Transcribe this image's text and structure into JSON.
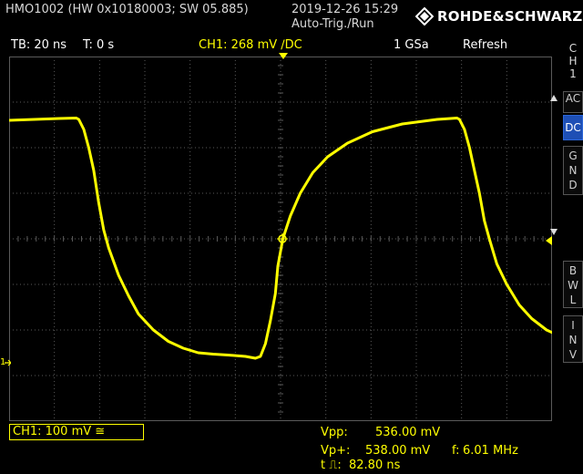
{
  "header": {
    "device": "HMO1002 (HW 0x10180003; SW 05.885)",
    "datetime": "2019-12-26 15:29",
    "mode": "Auto-Trig./Run",
    "brand": "ROHDE&SCHWARZ"
  },
  "status": {
    "timebase": "TB: 20 ns",
    "trigger_time": "T: 0 s",
    "channel": "CH1: 268 mV ∕DC",
    "sample_rate": "1 GSa",
    "acquisition": "Refresh"
  },
  "sidebar": {
    "channel_label": "C\nH\n1",
    "buttons": [
      {
        "label": "AC"
      },
      {
        "label": "DC"
      },
      {
        "label": "G\nN\nD"
      },
      {
        "label": "B\nW\nL"
      },
      {
        "label": "I\nN\nV"
      }
    ]
  },
  "footer": {
    "channel_scale": "CH1: 100 mV ≅",
    "vpp_label": "Vpp:",
    "vpp_value": "536.00 mV",
    "vpmax_label": "Vp+:",
    "vpmax_value": "538.00 mV",
    "freq_label": "f:",
    "freq_value": "6.01 MHz",
    "tw_label": "t ⎍:",
    "tw_value": "82.80 ns"
  },
  "colors": {
    "trace": "#ffff00",
    "grid": "#5a5a5a",
    "active_button": "#1e4fb5"
  },
  "waveform": {
    "time_per_div_ns": 20,
    "volts_per_div_mv": 100,
    "points_mv": [
      [
        0,
        260
      ],
      [
        10,
        262
      ],
      [
        20,
        264
      ],
      [
        27,
        265
      ],
      [
        28,
        262
      ],
      [
        30,
        240
      ],
      [
        32,
        200
      ],
      [
        34,
        150
      ],
      [
        36,
        80
      ],
      [
        38,
        20
      ],
      [
        40,
        -20
      ],
      [
        44,
        -80
      ],
      [
        48,
        -125
      ],
      [
        52,
        -165
      ],
      [
        58,
        -200
      ],
      [
        64,
        -225
      ],
      [
        70,
        -240
      ],
      [
        76,
        -250
      ],
      [
        82,
        -253
      ],
      [
        88,
        -255
      ],
      [
        95,
        -258
      ],
      [
        99,
        -262
      ],
      [
        101,
        -258
      ],
      [
        103,
        -230
      ],
      [
        105,
        -180
      ],
      [
        107,
        -120
      ],
      [
        108,
        -60
      ],
      [
        110,
        0
      ],
      [
        113,
        50
      ],
      [
        117,
        100
      ],
      [
        122,
        145
      ],
      [
        128,
        180
      ],
      [
        136,
        210
      ],
      [
        146,
        235
      ],
      [
        158,
        252
      ],
      [
        172,
        262
      ],
      [
        180,
        265
      ],
      [
        181,
        262
      ],
      [
        183,
        240
      ],
      [
        185,
        200
      ],
      [
        187,
        150
      ],
      [
        189,
        100
      ],
      [
        191,
        40
      ],
      [
        193,
        0
      ],
      [
        196,
        -55
      ],
      [
        200,
        -100
      ],
      [
        205,
        -145
      ],
      [
        210,
        -175
      ],
      [
        216,
        -200
      ],
      [
        222,
        -215
      ],
      [
        226,
        -222
      ]
    ]
  },
  "icons": {
    "trigger_marker": "trigger-level-icon",
    "ground_marker": "ground-marker-icon"
  }
}
